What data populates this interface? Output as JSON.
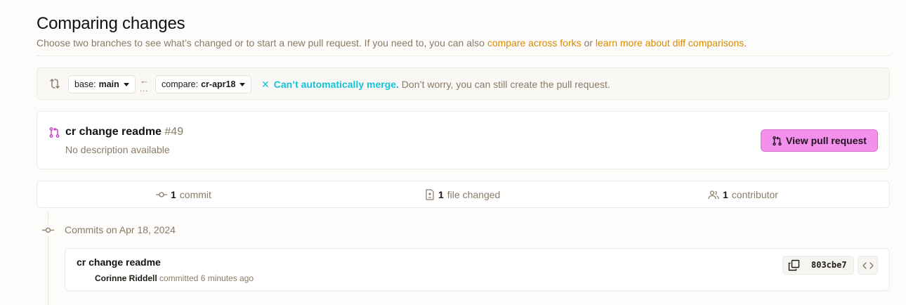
{
  "header": {
    "title": "Comparing changes",
    "subtitle_text": "Choose two branches to see what’s changed or to start a new pull request. If you need to, you can also ",
    "link_forks": "compare across forks",
    "subtitle_or": " or ",
    "link_learn": "learn more about diff comparisons",
    "subtitle_end": "."
  },
  "compare": {
    "base_prefix": "base:",
    "base_branch": "main",
    "compare_prefix": "compare:",
    "compare_branch": "cr-apr18",
    "arrow": "←",
    "dots": "...",
    "merge_icon": "✕",
    "merge_status": "Can’t automatically merge.",
    "merge_note": " Don’t worry, you can still create the pull request."
  },
  "pull_request": {
    "title": "cr change readme",
    "number": "#49",
    "description": "No description available",
    "view_button": "View pull request"
  },
  "stats": {
    "commits_count": "1",
    "commits_label": "commit",
    "files_count": "1",
    "files_label": "file changed",
    "contributors_count": "1",
    "contributors_label": "contributor"
  },
  "timeline": {
    "heading": "Commits on Apr 18, 2024",
    "commits": [
      {
        "message": "cr change readme",
        "author": "Corinne Riddell",
        "action": " committed 6 minutes ago",
        "sha": "803cbe7"
      }
    ]
  },
  "colors": {
    "accent_link": "#d68b00",
    "merge_error": "#14c4d6",
    "pr_button": "#f290ec",
    "pr_icon": "#c43fbf"
  }
}
